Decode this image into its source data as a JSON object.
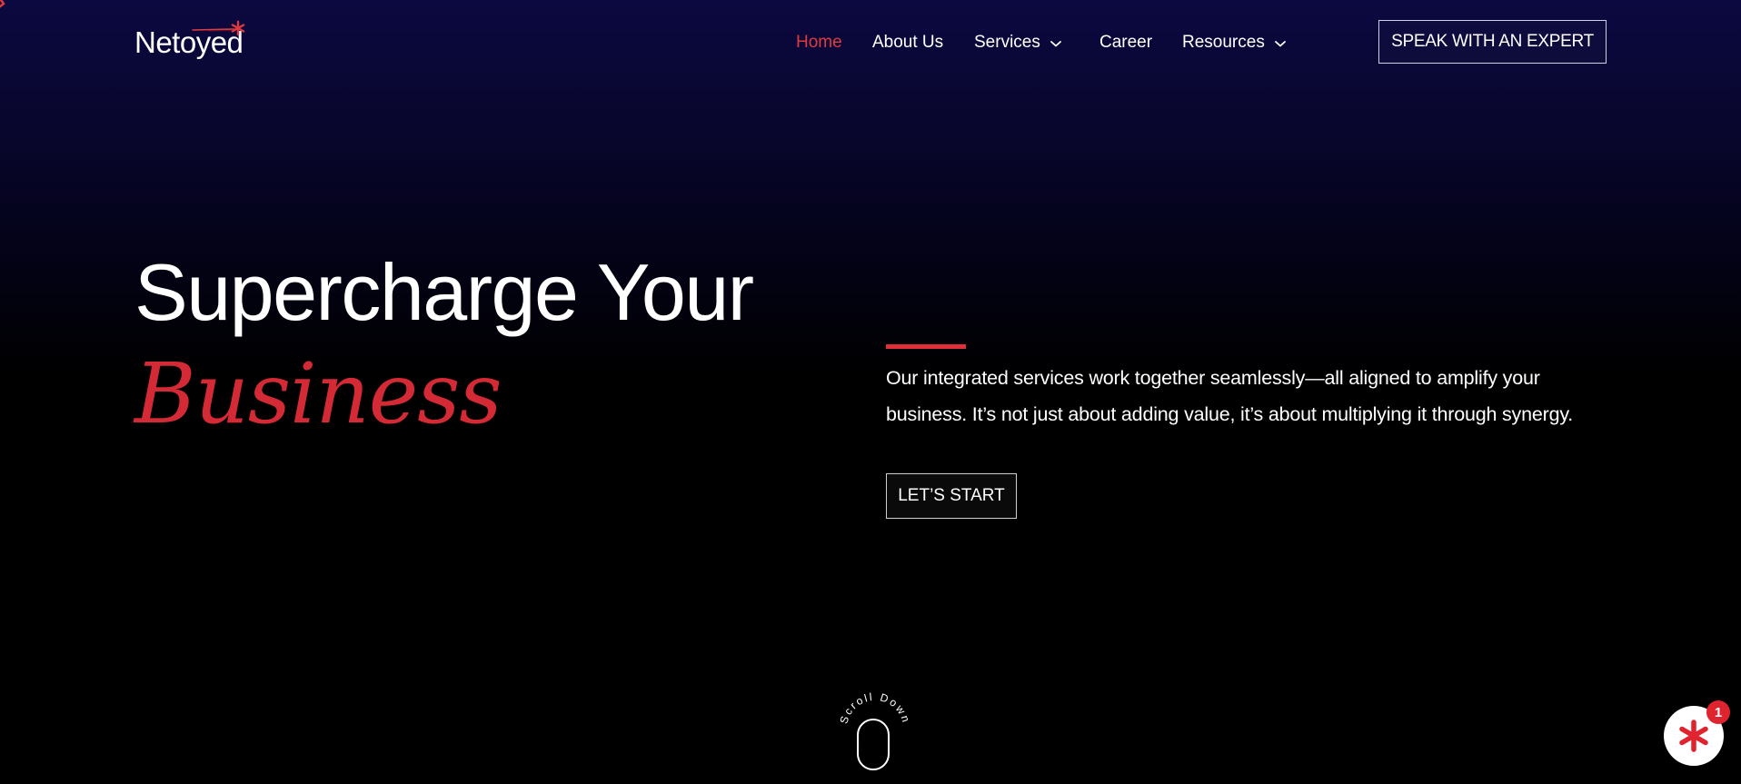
{
  "brand": {
    "name": "Netoyed",
    "accent_color": "#e03a3e",
    "logo_mark_icon": "asterisk-spark-icon"
  },
  "nav": {
    "items": [
      {
        "label": "Home",
        "active": true
      },
      {
        "label": "About Us",
        "active": false
      },
      {
        "label": "Services",
        "active": false,
        "dropdown": true
      },
      {
        "label": "Career",
        "active": false
      },
      {
        "label": "Resources",
        "active": false,
        "dropdown": true
      }
    ],
    "cta_label": "SPEAK WITH AN EXPERT"
  },
  "hero": {
    "title_line1": "Supercharge Your",
    "title_line2": "Business",
    "description": "Our integrated services work together seamlessly—all aligned to amplify your business. It’s not just about adding value, it’s about multiplying it through synergy.",
    "cta_label": "LET’S START"
  },
  "scroll": {
    "label": "Scroll Down"
  },
  "chat": {
    "icon": "asterisk-icon",
    "badge_count": "1"
  },
  "colors": {
    "accent": "#e03a3e",
    "background_top": "#0b0940",
    "background_bottom": "#000000",
    "text": "#ffffff"
  }
}
